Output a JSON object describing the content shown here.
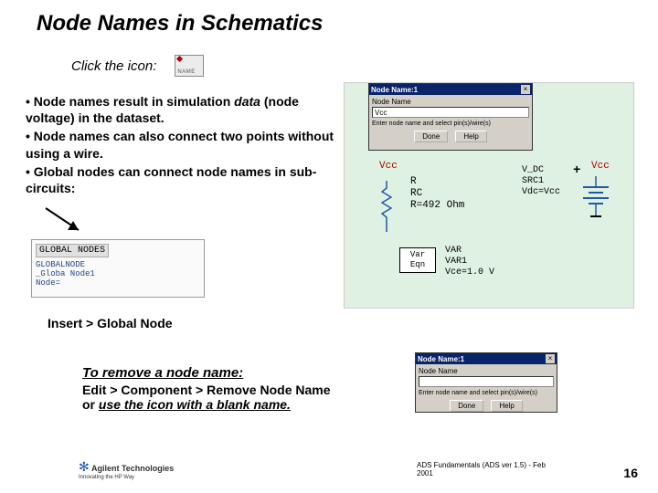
{
  "title": "Node Names in Schematics",
  "click_line": "Click the icon:",
  "name_icon_label": "NAME",
  "bullets": {
    "b1_pre": "• Node names result in  simulation ",
    "b1_em": "data",
    "b1_post": " (node voltage) in the dataset.",
    "b2": "• Node names can also connect two points without using a wire.",
    "b3": "• Global nodes can connect node names in sub-circuits:"
  },
  "global_box": {
    "header": "GLOBAL NODES",
    "l1": "GLOBALNODE",
    "l2": "_Globa Node1",
    "l3": "Node="
  },
  "insert_path": "Insert > Global Node",
  "remove": {
    "heading": "To remove a node name:",
    "line1": "Edit > Component > Remove Node Name",
    "line2_pre": "or ",
    "line2_em": "use the icon with a blank name."
  },
  "dialog1": {
    "title": "Node Name:1",
    "close": "×",
    "label": "Node Name",
    "value": "Vcc",
    "instr": "Enter node name and select pin(s)/wire(s)",
    "done": "Done",
    "help": "Help"
  },
  "dialog2": {
    "title": "Node Name:1",
    "close": "×",
    "label": "Node Name",
    "value": "",
    "instr": "Enter node name and select pin(s)/wire(s)",
    "done": "Done",
    "help": "Help"
  },
  "schematic": {
    "vcc1": "Vcc",
    "vcc2": "Vcc",
    "r_l1": "R",
    "r_l2": "RC",
    "r_l3": "R=492 Ohm",
    "vdc_l1": "V_DC",
    "vdc_l2": "SRC1",
    "vdc_l3": "Vdc=Vcc",
    "plus": "+",
    "var_box_l1": "Var",
    "var_box_l2": "Eqn",
    "var_l1": "VAR",
    "var_l2": "VAR1",
    "var_l3": "Vce=1.0 V"
  },
  "footer": "ADS Fundamentals (ADS ver 1.5) - Feb 2001",
  "page": "16",
  "logo": {
    "company": "Agilent Technologies",
    "tag": "Innovating the HP Way"
  }
}
